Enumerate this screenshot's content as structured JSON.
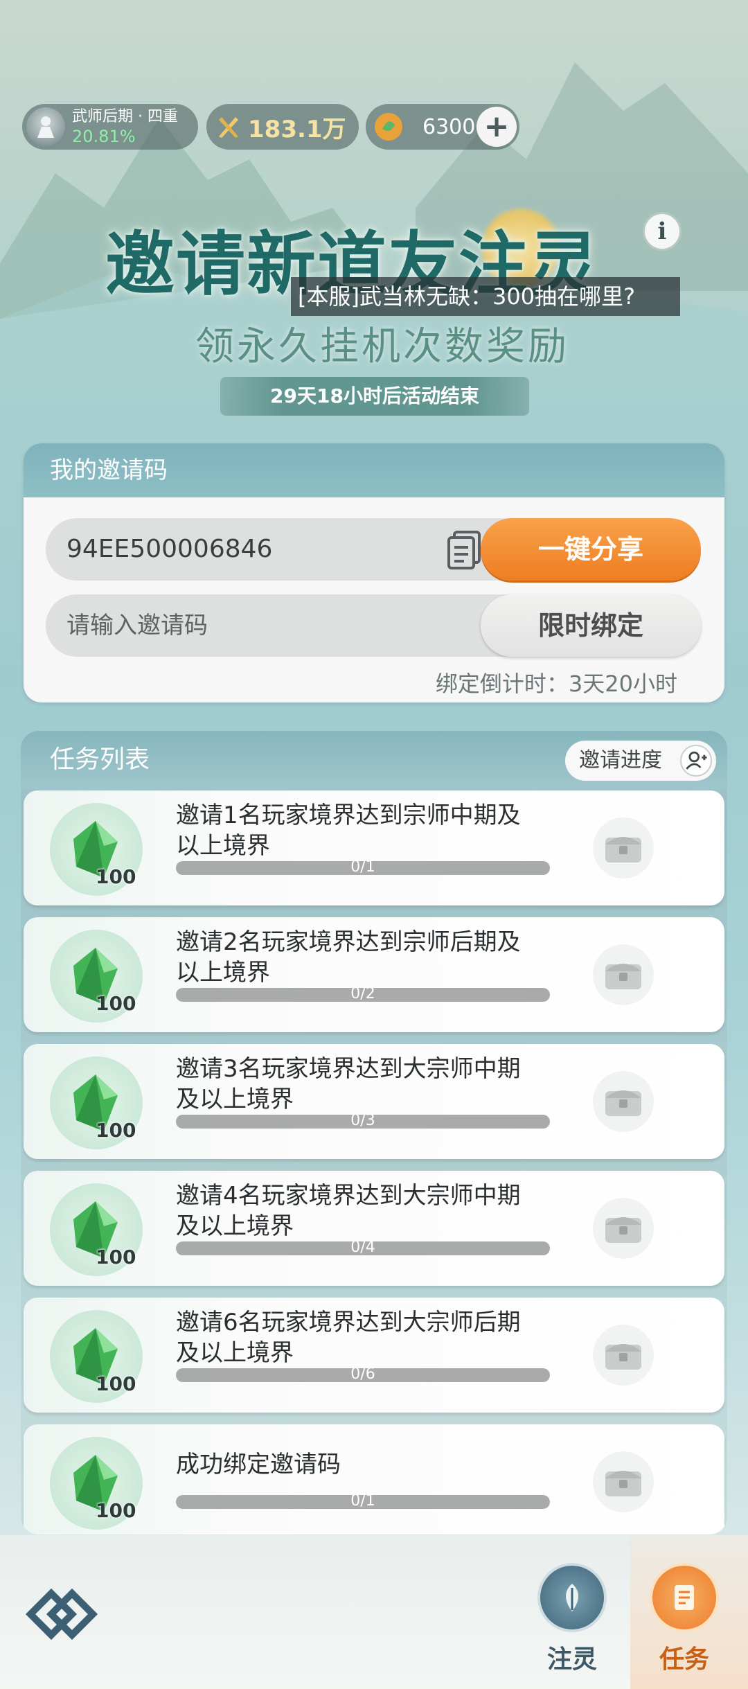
{
  "status": {
    "realm_name": "武师后期 · 四重",
    "realm_progress": "20.81%",
    "power": "183.1万",
    "coins": "6300",
    "add_label": "+"
  },
  "banner": {
    "title": "邀请新道友注灵",
    "subtitle": "领永久挂机次数奖励",
    "info_label": "i",
    "chat_message": "[本服]武当林无缺：300抽在哪里?",
    "event_timer": "29天18小时后活动结束"
  },
  "invite": {
    "header": "我的邀请码",
    "code": "94EE500006846",
    "share_label": "一键分享",
    "input_placeholder": "请输入邀请码",
    "bind_label": "限时绑定",
    "countdown": "绑定倒计时：3天20小时"
  },
  "tasks": {
    "header": "任务列表",
    "progress_button": "邀请进度",
    "items": [
      {
        "desc": "邀请1名玩家境界达到宗师中期及以上境界",
        "reward": "100",
        "progress_text": "0/1",
        "progress": 0
      },
      {
        "desc": "邀请2名玩家境界达到宗师后期及以上境界",
        "reward": "100",
        "progress_text": "0/2",
        "progress": 0
      },
      {
        "desc": "邀请3名玩家境界达到大宗师中期及以上境界",
        "reward": "100",
        "progress_text": "0/3",
        "progress": 0
      },
      {
        "desc": "邀请4名玩家境界达到大宗师中期及以上境界",
        "reward": "100",
        "progress_text": "0/4",
        "progress": 0
      },
      {
        "desc": "邀请6名玩家境界达到大宗师后期及以上境界",
        "reward": "100",
        "progress_text": "0/6",
        "progress": 0
      },
      {
        "desc": "成功绑定邀请码",
        "reward": "100",
        "progress_text": "0/1",
        "progress": 0
      }
    ]
  },
  "nav": {
    "inject_label": "注灵",
    "task_label": "任务",
    "active": "任务"
  },
  "icons": {
    "realm": "warrior-avatar-icon",
    "power": "crossed-swords-icon",
    "coin": "spirit-coin-icon",
    "copy": "copy-icon",
    "reward": "green-gem-icon",
    "chest": "locked-chest-icon",
    "progress": "user-add-icon",
    "logo": "game-logo-icon",
    "inject": "leaf-icon",
    "task": "scroll-icon"
  },
  "colors": {
    "accent_orange": "#ee7d22",
    "title_teal": "#1f6a66",
    "progress_green": "#8ef0a8"
  }
}
